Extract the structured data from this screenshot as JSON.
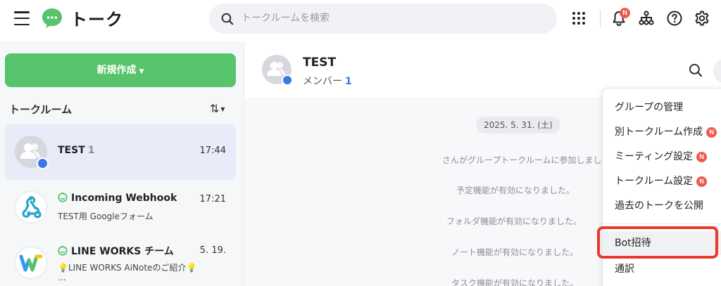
{
  "header": {
    "title": "トーク",
    "search_placeholder": "トークルームを検索",
    "notification_badge": "N"
  },
  "sidebar": {
    "new_button": "新規作成",
    "section_title": "トークルーム",
    "sort_icon": "⇅",
    "rooms": [
      {
        "name": "TEST",
        "count": "1",
        "time": "17:44",
        "active": true
      },
      {
        "name": "Incoming Webhook",
        "time": "17:21",
        "preview": "TEST用 Googleフォーム"
      },
      {
        "name": "LINE WORKS チーム",
        "time": "5. 19.",
        "preview": "💡LINE WORKS AiNoteのご紹介💡",
        "preview2": "..."
      }
    ]
  },
  "chat": {
    "title": "TEST",
    "members_label": "メンバー",
    "members_count": "1",
    "date": "2025. 5. 31. (土)",
    "messages": [
      "さんがグループトークルームに参加しました。",
      "予定機能が有効になりました。",
      "フォルダ機能が有効になりました。",
      "ノート機能が有効になりました。",
      "タスク機能が有効になりました。"
    ]
  },
  "menu": {
    "items": [
      {
        "label": "グループの管理",
        "badge": ""
      },
      {
        "label": "別トークルーム作成",
        "badge": "N"
      },
      {
        "label": "ミーティング設定",
        "badge": "N"
      },
      {
        "label": "トークルーム設定",
        "badge": "N"
      },
      {
        "label": "過去のトークを公開",
        "badge": ""
      },
      {
        "label": "Bot招待",
        "badge": ""
      },
      {
        "label": "通訳",
        "badge": ""
      }
    ]
  },
  "colors": {
    "accent_green": "#57c46b",
    "badge_red": "#f05a4c",
    "highlight_red": "#e8392c",
    "member_blue": "#3b78e7"
  }
}
